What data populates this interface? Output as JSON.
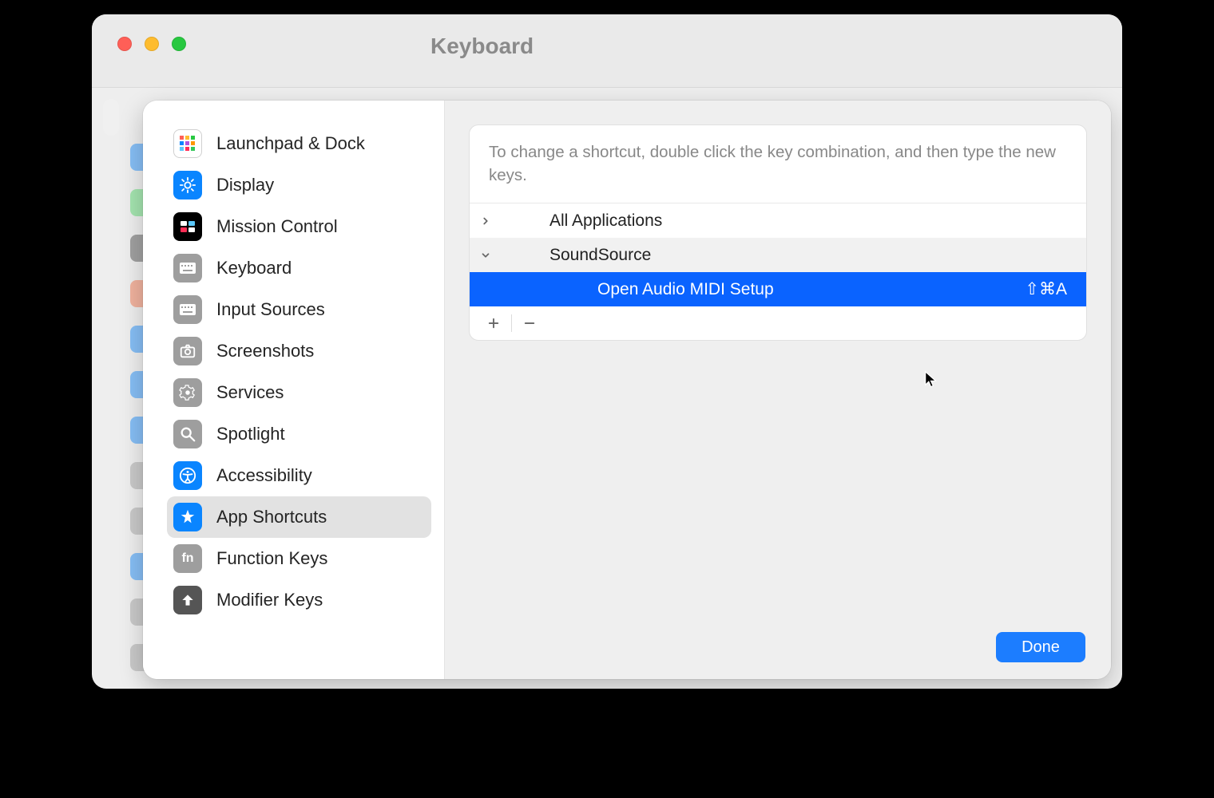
{
  "window": {
    "title": "Keyboard"
  },
  "sidebar": {
    "items": [
      {
        "label": "Launchpad & Dock"
      },
      {
        "label": "Display"
      },
      {
        "label": "Mission Control"
      },
      {
        "label": "Keyboard"
      },
      {
        "label": "Input Sources"
      },
      {
        "label": "Screenshots"
      },
      {
        "label": "Services"
      },
      {
        "label": "Spotlight"
      },
      {
        "label": "Accessibility"
      },
      {
        "label": "App Shortcuts"
      },
      {
        "label": "Function Keys"
      },
      {
        "label": "Modifier Keys"
      }
    ],
    "selected_index": 9
  },
  "pane": {
    "help_text": "To change a shortcut, double click the key combination, and then type the new keys.",
    "rows": [
      {
        "kind": "group-collapsed",
        "name": "All Applications"
      },
      {
        "kind": "group-expanded",
        "name": "SoundSource"
      },
      {
        "kind": "child-selected",
        "name": "Open Audio MIDI Setup",
        "shortcut": "⇧⌘A"
      }
    ]
  },
  "footer": {
    "done_label": "Done"
  }
}
